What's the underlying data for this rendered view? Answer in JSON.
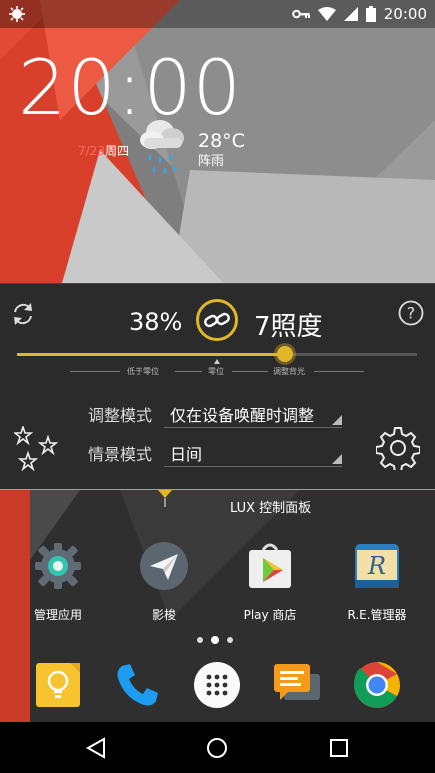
{
  "status_bar": {
    "time": "20:00",
    "icons": [
      "app-notification-icon",
      "key-icon",
      "wifi-icon",
      "cell-signal-icon",
      "battery-icon"
    ]
  },
  "clock_widget": {
    "time": "20:00",
    "date": "7/23",
    "weekday": "周四",
    "temperature": "28°C",
    "condition": "阵雨",
    "weather_icon": "rain-cloud-icon"
  },
  "lux_panel": {
    "percent": "38%",
    "lux_value": "7照度",
    "slider_level": 0.67,
    "scale_labels": {
      "below_zero": "低于零位",
      "zero": "零位",
      "adjust_backlight": "调整背光"
    },
    "adjust_mode_label": "调整模式",
    "adjust_mode_value": "仅在设备唤醒时调整",
    "scene_mode_label": "情景模式",
    "scene_mode_value": "日间",
    "caption": "LUX 控制面板",
    "accent": "#e0b62a"
  },
  "apps": [
    {
      "label": "管理应用",
      "icon": "gear-app-icon"
    },
    {
      "label": "影梭",
      "icon": "paper-plane-icon"
    },
    {
      "label": "Play 商店",
      "icon": "play-store-icon"
    },
    {
      "label": "R.E.管理器",
      "icon": "re-manager-icon"
    }
  ],
  "dock": [
    {
      "icon": "keep-lightbulb-icon"
    },
    {
      "icon": "phone-icon"
    },
    {
      "icon": "app-drawer-icon"
    },
    {
      "icon": "messages-icon"
    },
    {
      "icon": "chrome-icon"
    }
  ],
  "nav_bar": {
    "buttons": [
      "back-icon",
      "home-icon",
      "recents-icon"
    ]
  },
  "colors": {
    "wallpaper_red": "#e24a35",
    "wallpaper_grey": "#8a8a8a",
    "accent_gold": "#e0b62a"
  }
}
